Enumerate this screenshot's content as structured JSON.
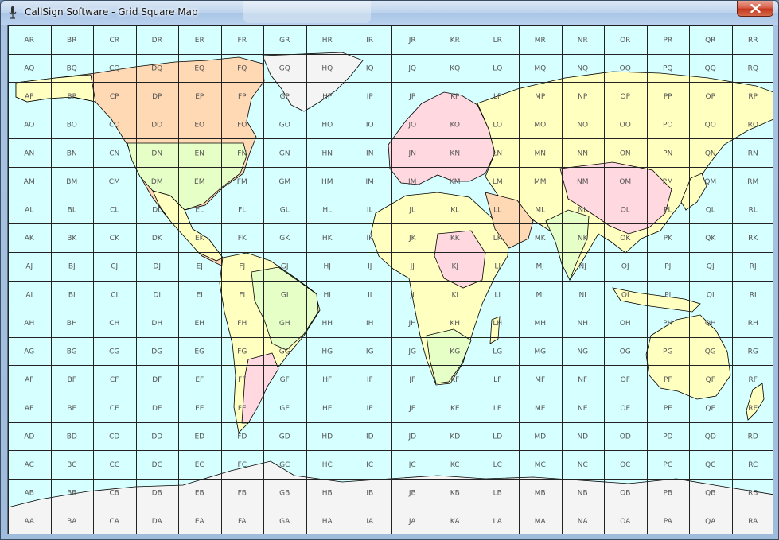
{
  "window": {
    "title": "CallSign Software - Grid Square Map",
    "icons": {
      "app": "microphone-icon",
      "close": "close-icon"
    }
  },
  "map": {
    "colors": {
      "ocean": "#d6ffff",
      "grid_line": "#222222",
      "label": "#555555",
      "land_yellow": "#ffffc0",
      "land_green": "#e6ffc6",
      "land_pink": "#ffd8e0",
      "land_orange": "#ffd8b4",
      "ice": "#f4f4f4",
      "border": "#000000"
    },
    "field_columns": [
      "A",
      "B",
      "C",
      "D",
      "E",
      "F",
      "G",
      "H",
      "I",
      "J",
      "K",
      "L",
      "M",
      "N",
      "O",
      "P",
      "Q",
      "R"
    ],
    "field_rows_top_to_bottom": [
      "R",
      "Q",
      "P",
      "O",
      "N",
      "M",
      "L",
      "K",
      "J",
      "I",
      "H",
      "G",
      "F",
      "E",
      "D",
      "C",
      "B",
      "A"
    ]
  }
}
